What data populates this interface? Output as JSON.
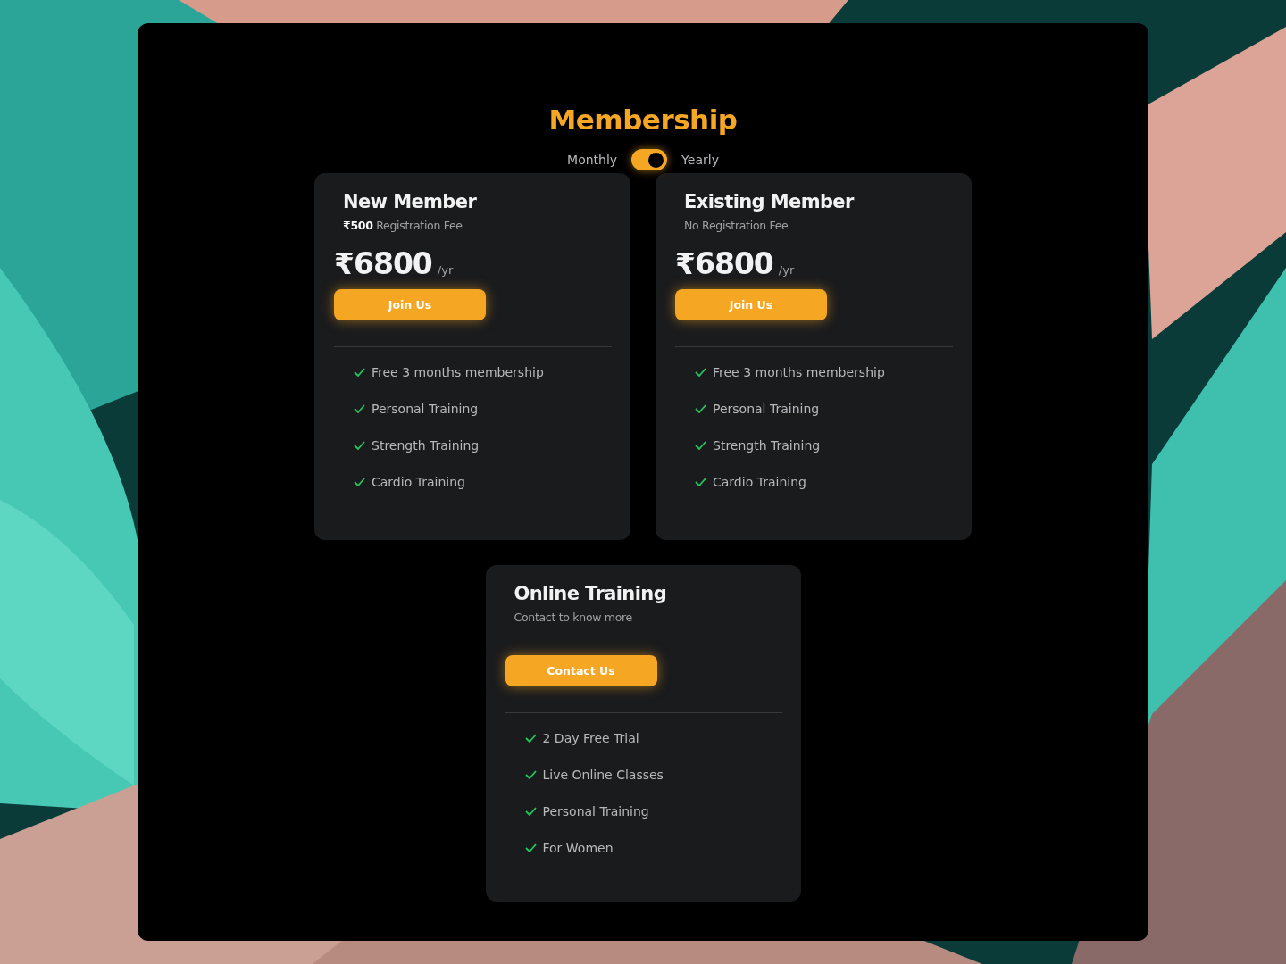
{
  "title": "Membership",
  "billing_toggle": {
    "left_label": "Monthly",
    "right_label": "Yearly",
    "on": true
  },
  "plans": [
    {
      "name": "New Member",
      "subtitle": "**₹500** Registration Fee",
      "price": "₹6800",
      "period": "/yr",
      "button": "Join Us",
      "features": [
        "Free 3 months membership",
        "Personal Training",
        "Strength Training",
        "Cardio Training"
      ]
    },
    {
      "name": "Existing Member",
      "subtitle": "No Registration Fee",
      "price": "₹6800",
      "period": "/yr",
      "button": "Join Us",
      "features": [
        "Free 3 months membership",
        "Personal Training",
        "Strength Training",
        "Cardio Training"
      ]
    },
    {
      "name": "Online Training",
      "subtitle": "Contact to know more",
      "button": "Contact Us",
      "features": [
        "2 Day Free Trial",
        "Live Online Classes",
        "Personal Training",
        "For Women"
      ]
    }
  ]
}
